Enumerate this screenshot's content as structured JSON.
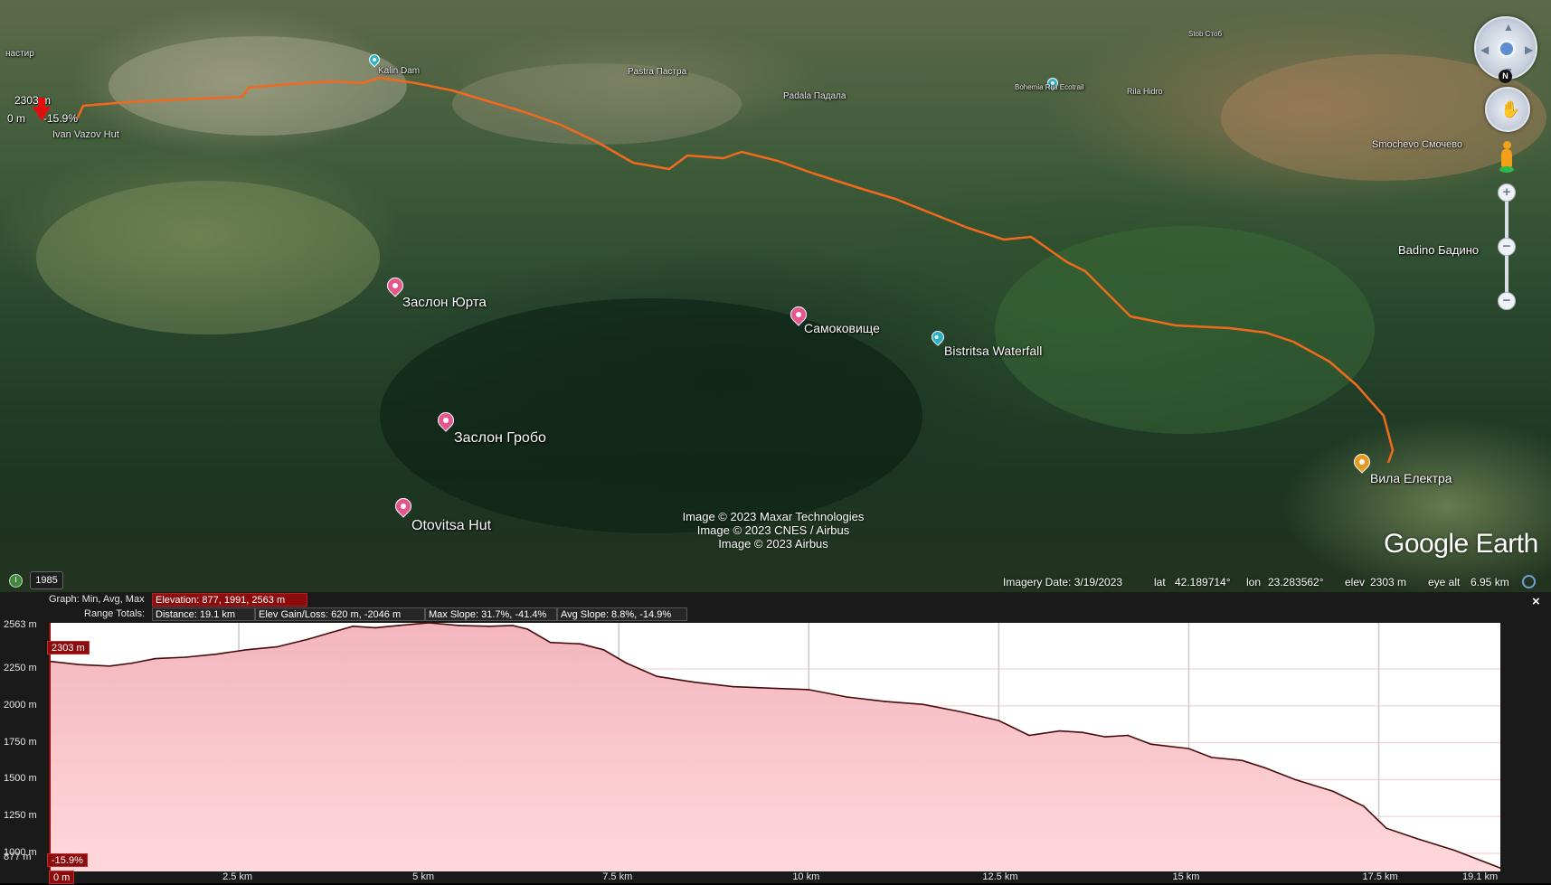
{
  "map": {
    "labels": {
      "manastir": "настир",
      "kalin_dam": "Kalin Dam",
      "pastra": "Pastra Пастра",
      "padala": "Padala Падала",
      "bohemia": "Bohemia Rila Ecotrail",
      "rila_hydro": "Rila Hidro",
      "stob": "Stob Стоб",
      "smochevo": "Smochevo Смочево",
      "badino": "Badino Бадино",
      "top_town": "Pastra Pastra",
      "ivan_vazov": "Ivan Vazov Hut",
      "zaslon_yurta": "Заслон Юрта",
      "samokovishte": "Самоковище",
      "bistritsa": "Bistritsa Waterfall",
      "zaslon_grobo": "Заслон Гробо",
      "otovitsa": "Otovitsa Hut",
      "vila_elektra": "Вила Електра"
    },
    "cursor_readout": {
      "elevation": "2303 m",
      "distance": "0 m",
      "slope": "-15.9%"
    },
    "attribution": {
      "line1": "Image © 2023 Maxar Technologies",
      "line2": "Image © 2023 CNES / Airbus",
      "line3": "Image © 2023 Airbus"
    },
    "logo": "Google Earth",
    "icons": {
      "look": "look-around-eye-icon",
      "north": "north-indicator-icon",
      "move": "hand-move-icon",
      "pegman": "street-view-pegman-icon",
      "zoom_in": "zoom-in-icon",
      "zoom_out": "zoom-out-icon"
    },
    "north_label": "N",
    "zoom_in_label": "+",
    "zoom_out_label": "−",
    "zoom_mid_label": "−"
  },
  "status": {
    "year": "1985",
    "imagery_date": "Imagery Date: 3/19/2023",
    "lat_label": "lat",
    "lat_value": "42.189714°",
    "lon_label": "lon",
    "lon_value": "23.283562°",
    "elev_label": "elev",
    "elev_value": "2303 m",
    "eye_alt_label": "eye alt",
    "eye_alt_value": "6.95 km"
  },
  "profile": {
    "header": {
      "graph_label": "Graph: Min, Avg, Max",
      "elevation_stats": "Elevation: 877, 1991, 2563 m",
      "range_totals_label": "Range Totals:",
      "distance": "Distance: 19.1 km",
      "elev_gain_loss": "Elev Gain/Loss: 620 m, -2046 m",
      "max_slope": "Max Slope: 31.7%, -41.4%",
      "avg_slope": "Avg Slope: 8.8%, -14.9%"
    },
    "close_label": "×",
    "cursor_elev_box": "2303 m",
    "cursor_slope_box": "-15.9%",
    "cursor_dist_box": "0 m",
    "colors": {
      "fill_top": "#f3b6bd",
      "fill_bottom": "#ffd8dc",
      "line": "#4a0a0a",
      "marker": "#8a0c0c"
    }
  },
  "chart_data": {
    "type": "area",
    "title": "",
    "xlabel": "",
    "ylabel": "",
    "x_unit": "km",
    "y_unit": "m",
    "xlim": [
      0,
      19.1
    ],
    "ylim": [
      877,
      2563
    ],
    "y_ticks": [
      "2563 m",
      "2250 m",
      "2000 m",
      "1750 m",
      "1500 m",
      "1250 m",
      "1000 m",
      "877 m"
    ],
    "y_tick_values": [
      2563,
      2250,
      2000,
      1750,
      1500,
      1250,
      1000,
      877
    ],
    "x_ticks": [
      "0 m",
      "2.5 km",
      "5 km",
      "7.5 km",
      "10 km",
      "12.5 km",
      "15 km",
      "17.5 km",
      "19.1 km"
    ],
    "x_tick_values": [
      0,
      2.5,
      5,
      7.5,
      10,
      12.5,
      15,
      17.5,
      19.1
    ],
    "grid": true,
    "series": [
      {
        "values": [
          [
            0,
            2303
          ],
          [
            0.4,
            2280
          ],
          [
            0.8,
            2270
          ],
          [
            1.1,
            2290
          ],
          [
            1.4,
            2320
          ],
          [
            1.8,
            2330
          ],
          [
            2.2,
            2350
          ],
          [
            2.6,
            2380
          ],
          [
            3.0,
            2400
          ],
          [
            3.4,
            2450
          ],
          [
            3.8,
            2510
          ],
          [
            4.0,
            2540
          ],
          [
            4.3,
            2530
          ],
          [
            4.6,
            2545
          ],
          [
            5.0,
            2563
          ],
          [
            5.4,
            2545
          ],
          [
            5.8,
            2540
          ],
          [
            6.1,
            2545
          ],
          [
            6.3,
            2520
          ],
          [
            6.6,
            2430
          ],
          [
            7.0,
            2420
          ],
          [
            7.3,
            2380
          ],
          [
            7.6,
            2290
          ],
          [
            8.0,
            2200
          ],
          [
            8.5,
            2160
          ],
          [
            9.0,
            2130
          ],
          [
            9.5,
            2120
          ],
          [
            10.0,
            2110
          ],
          [
            10.5,
            2060
          ],
          [
            11.0,
            2030
          ],
          [
            11.5,
            2010
          ],
          [
            12.0,
            1960
          ],
          [
            12.5,
            1900
          ],
          [
            12.9,
            1800
          ],
          [
            13.3,
            1830
          ],
          [
            13.6,
            1820
          ],
          [
            13.9,
            1790
          ],
          [
            14.2,
            1800
          ],
          [
            14.5,
            1740
          ],
          [
            15.0,
            1710
          ],
          [
            15.3,
            1650
          ],
          [
            15.7,
            1630
          ],
          [
            16.0,
            1580
          ],
          [
            16.4,
            1500
          ],
          [
            16.9,
            1420
          ],
          [
            17.3,
            1320
          ],
          [
            17.6,
            1170
          ],
          [
            18.0,
            1100
          ],
          [
            18.5,
            1020
          ],
          [
            18.8,
            960
          ],
          [
            19.1,
            900
          ]
        ]
      }
    ]
  }
}
